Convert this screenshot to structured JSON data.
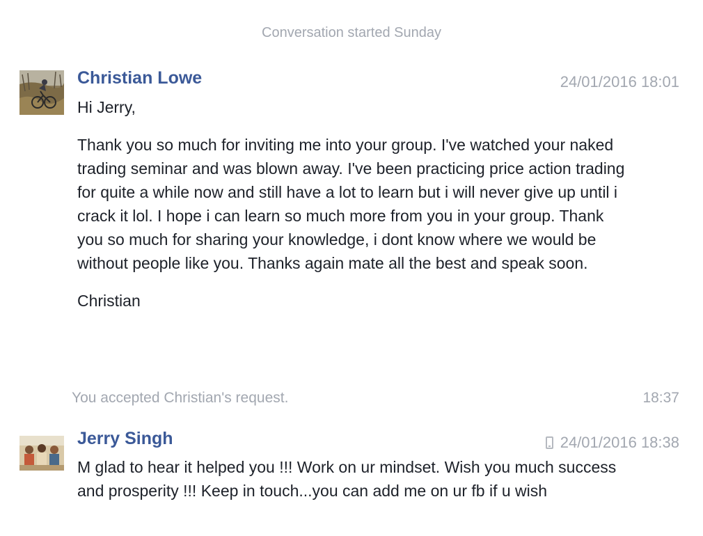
{
  "conversation": {
    "started_label": "Conversation started Sunday"
  },
  "messages": [
    {
      "sender": "Christian Lowe",
      "timestamp": "24/01/2016 18:01",
      "avatar_icon": "profile-photo-mountain-biker",
      "paragraphs": [
        "Hi Jerry,",
        "Thank you so much for inviting me into your group. I've watched your naked trading seminar and was blown away. I've been practicing price action trading for quite a while now and still have a lot to learn but i will never give up until i crack it lol. I hope i can learn so much more from you in your group. Thank you so much for sharing your knowledge, i dont know where we would be without people like you. Thanks again mate all the best and speak soon.",
        "Christian"
      ]
    },
    {
      "sender": "Jerry Singh",
      "timestamp": "24/01/2016 18:38",
      "sent_from_icon": "mobile-phone-icon",
      "avatar_icon": "profile-photo-group",
      "paragraphs": [
        "M glad to hear it helped you !!! Work on ur mindset. Wish you much success and prosperity !!! Keep in touch...you can add me on ur fb if u wish"
      ]
    }
  ],
  "system_event": {
    "text": "You accepted Christian's request.",
    "time": "18:37"
  },
  "colors": {
    "name_link": "#3b5998",
    "meta_gray": "#a2a7b0",
    "body_text": "#1d2129"
  }
}
